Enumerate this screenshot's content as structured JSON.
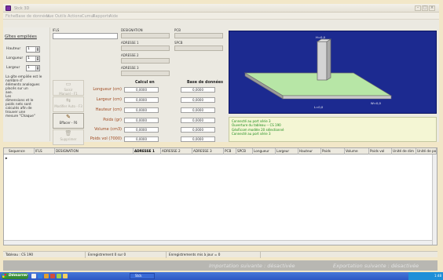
{
  "window": {
    "title": "Stck 3D"
  },
  "menu": [
    "Fiche",
    "Base de données",
    "Vue",
    "Outils",
    "Actions",
    "Cumul",
    "Rapports",
    "Aide"
  ],
  "left_panel": {
    "title": "Gîtes empilées",
    "fields": [
      {
        "label": "Hauteur",
        "value": "1"
      },
      {
        "label": "Longueur",
        "value": "1"
      },
      {
        "label": "Largeur",
        "value": "1"
      }
    ],
    "help": "La gîte empilée est le\nnombre d'\néléments analogues\nplacés sur un\naxe.\nLes\ndimensions et le\npoids nets sont\ncalculés afin de\ntrouver une\nmesure \"Chaque\""
  },
  "form": {
    "ifls_label": "IFLS",
    "designation_label": "DESIGNATION",
    "pcb_label": "PCB",
    "adresse1_label": "ADRESSE 1",
    "spcb_label": "SPCB",
    "adresse2_label": "ADRESSE 2",
    "adresse3_label": "ADRESSE 3"
  },
  "side_buttons": [
    {
      "label": "Saisir\nManuel - F1",
      "glyph": "▭",
      "enabled": false
    },
    {
      "label": "Modifier Auto - F3",
      "glyph": "⇆",
      "enabled": false
    },
    {
      "label": "Effacer - F6",
      "glyph": "✎",
      "enabled": true
    },
    {
      "label": "Supprimer",
      "glyph": "🗑",
      "enabled": false
    }
  ],
  "measures": {
    "col_calc": "Calcul en",
    "col_db": "Base de données",
    "rows": [
      {
        "label": "Longueur (cm)",
        "calc": "0,0000",
        "db": "0,0000"
      },
      {
        "label": "Largeur (cm)",
        "calc": "0,0000",
        "db": "0,0000"
      },
      {
        "label": "Hauteur (cm)",
        "calc": "0,0000",
        "db": "0,0000"
      },
      {
        "label": "Poids (gr)",
        "calc": "0,0000",
        "db": "0,0000"
      },
      {
        "label": "Volume (cm3)",
        "calc": "0,0000",
        "db": "0,0000"
      },
      {
        "label": "Poids vol (7000)",
        "calc": "0,0000",
        "db": "0,0000"
      }
    ]
  },
  "viewport": {
    "label_h": "H=0,0",
    "label_l": "L=0,0",
    "label_w": "W=0,0"
  },
  "log": [
    "Connecté au port série 3",
    "Ouverture du tableau -- CS 190",
    "GéoFicom modèle 20 sélectionné",
    "Connecté au port série 3"
  ],
  "grid": {
    "columns": [
      "Sequence",
      "IFLS",
      "DESIGNATION",
      "ADRESSE 1",
      "ADRESSE 2",
      "ADRESSE 3",
      "PCB",
      "SPCB",
      "Longueur",
      "Largeur",
      "Hauteur",
      "Poids",
      "Volume",
      "Poids vol",
      "Unité de dim",
      "Unité de po"
    ],
    "selected_column": "ADRESSE 1",
    "row_marker": "▸"
  },
  "status": {
    "table": "Tableau : CS 190",
    "saved": "Enregistrement 0 sur 0",
    "updated": "Enregistrements mis à jour = 0"
  },
  "export": {
    "import_next": "Importation suivante : désactivée",
    "export_next": "Exportation suivante : désactivée"
  },
  "taskbar": {
    "start": "Démarrer",
    "task": "Stck",
    "clock": "1:48"
  }
}
